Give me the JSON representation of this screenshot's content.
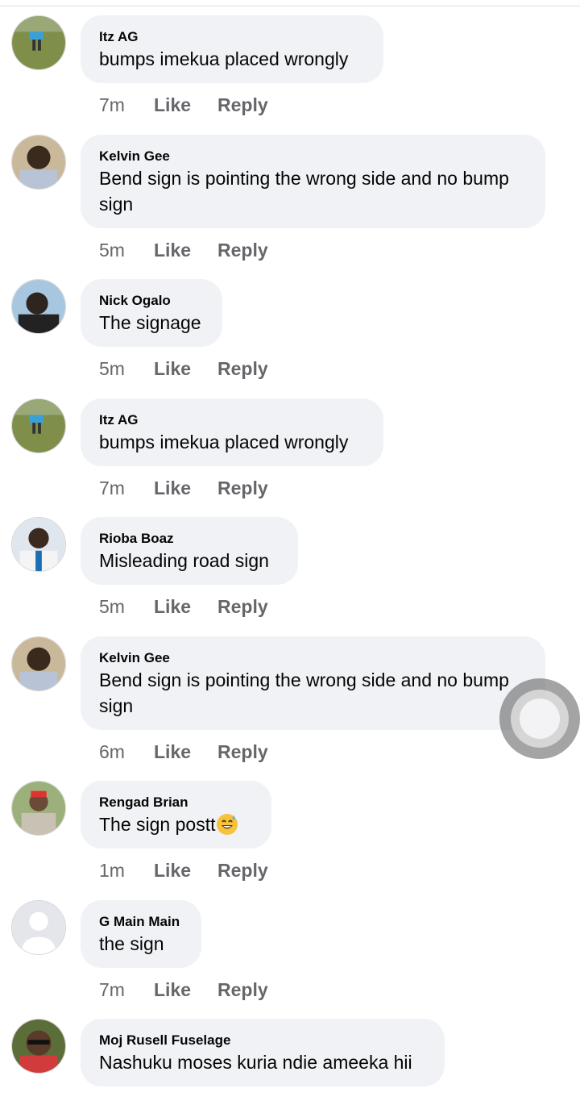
{
  "like_label": "Like",
  "reply_label": "Reply",
  "comments": [
    {
      "author": "Itz AG",
      "text": "bumps  imekua placed wrongly",
      "time": "7m"
    },
    {
      "author": "Kelvin Gee",
      "text": "Bend sign is pointing the wrong side and no bump sign",
      "time": "5m"
    },
    {
      "author": "Nick Ogalo",
      "text": "The signage",
      "time": "5m"
    },
    {
      "author": "Itz AG",
      "text": "bumps  imekua placed wrongly",
      "time": "7m"
    },
    {
      "author": "Rioba Boaz",
      "text": "Misleading road sign",
      "time": "5m"
    },
    {
      "author": "Kelvin Gee",
      "text": "Bend sign is pointing the wrong side and no bump sign",
      "time": "6m"
    },
    {
      "author": "Rengad Brian",
      "text": "The  sign postt",
      "time": "1m",
      "emoji": "grinning-sweat-emoji"
    },
    {
      "author": "G Main Main",
      "text": "the sign",
      "time": "7m"
    },
    {
      "author": "Moj Rusell Fuselage",
      "text": "Nashuku moses kuria ndie ameeka hii",
      "time": ""
    }
  ],
  "colors": {
    "bubble": "#f0f2f5",
    "meta": "#65676b",
    "text": "#050505"
  }
}
